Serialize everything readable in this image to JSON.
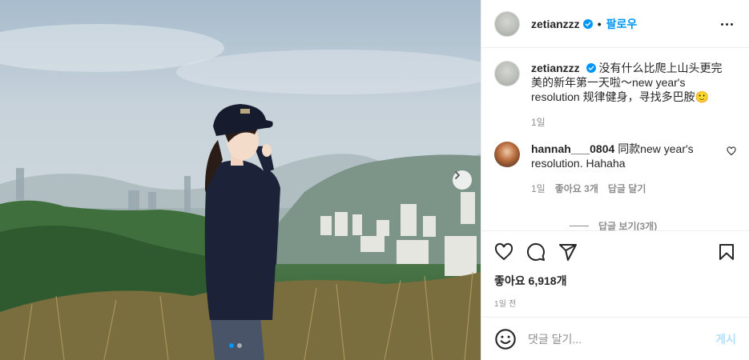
{
  "post": {
    "username": "zetianzzz",
    "follow_label": "팔로우",
    "separator": "•",
    "caption": "没有什么比爬上山头更完美的新年第一天啦～new year's resolution 规律健身，寻找多巴胺🙂",
    "caption_age": "1일"
  },
  "comment": {
    "username": "hannah___0804",
    "text": "同款new year's resolution. Hahaha",
    "age": "1일",
    "likes": "좋아요 3개",
    "reply": "답글 달기",
    "view_replies": "답글 보기(3개)"
  },
  "actions": {
    "likes_count": "좋아요 6,918개",
    "timestamp": "1일 전"
  },
  "comment_box": {
    "placeholder": "댓글 달기...",
    "post_label": "게시"
  },
  "icons": [
    "verified-badge-icon",
    "more-options-icon",
    "heart-icon",
    "comment-icon",
    "share-icon",
    "bookmark-icon",
    "emoji-icon",
    "chevron-right-icon"
  ],
  "carousel": {
    "slide_count": 2,
    "active_slide": 1
  },
  "colors": {
    "accent": "#0095f6",
    "text": "#262626",
    "muted": "#8e8e8e",
    "post_disabled": "#b2dffc"
  }
}
